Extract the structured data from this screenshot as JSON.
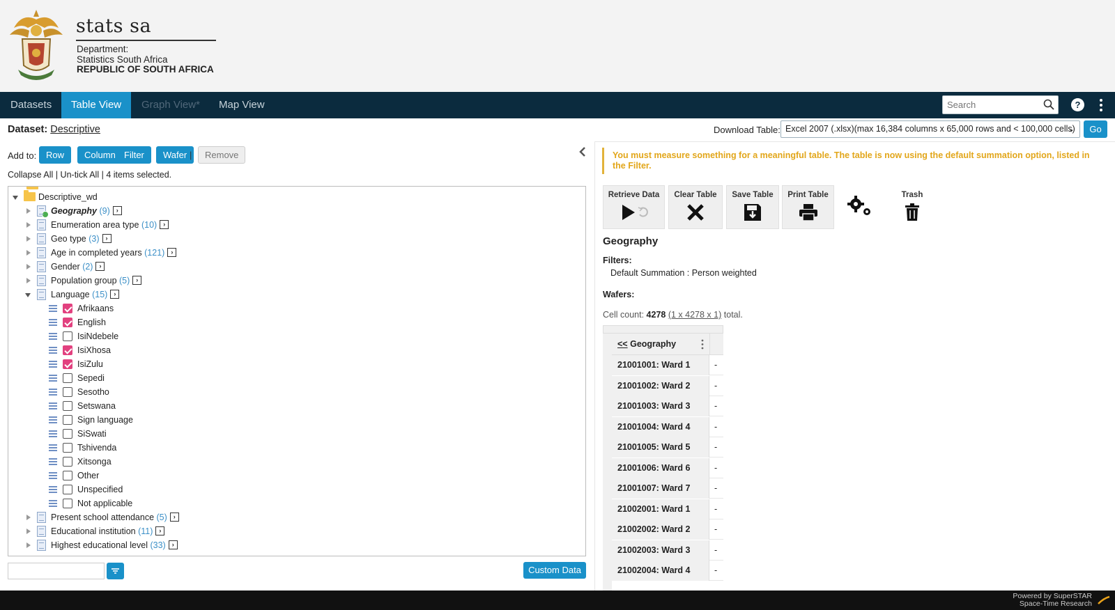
{
  "brand": {
    "name": "stats sa",
    "line1": "Department:",
    "line2": "Statistics South Africa",
    "line3": "REPUBLIC OF SOUTH AFRICA"
  },
  "nav": {
    "tabs": [
      {
        "label": "Datasets",
        "state": "normal"
      },
      {
        "label": "Table View",
        "state": "active"
      },
      {
        "label": "Graph View*",
        "state": "disabled"
      },
      {
        "label": "Map View",
        "state": "normal"
      }
    ],
    "search_placeholder": "Search"
  },
  "dataset": {
    "label": "Dataset:",
    "name": "Descriptive"
  },
  "download": {
    "label": "Download Table:",
    "selected": "Excel 2007 (.xlsx)(max 16,384 columns x 65,000 rows and < 100,000 cells)",
    "go": "Go"
  },
  "add_to": {
    "label": "Add to:",
    "buttons": [
      "Row",
      "Column",
      "Filter",
      "Wafer"
    ],
    "separator": "|",
    "remove": "Remove"
  },
  "collapse_bar": {
    "collapse_all": "Collapse All",
    "untick_all": "Un-tick All",
    "sep": "|",
    "selected_text": "4 items selected."
  },
  "tree": {
    "root": "Descriptive_wd",
    "nodes_before": [
      {
        "label": "Geography",
        "count": "(9)",
        "style": "geo"
      },
      {
        "label": "Enumeration area type",
        "count": "(10)"
      },
      {
        "label": "Geo type",
        "count": "(3)"
      },
      {
        "label": "Age in completed years",
        "count": "(121)"
      },
      {
        "label": "Gender",
        "count": "(2)"
      },
      {
        "label": "Population group",
        "count": "(5)"
      }
    ],
    "expanded": {
      "label": "Language",
      "count": "(15)"
    },
    "children": [
      {
        "label": "Afrikaans",
        "checked": true
      },
      {
        "label": "English",
        "checked": true
      },
      {
        "label": "IsiNdebele",
        "checked": false
      },
      {
        "label": "IsiXhosa",
        "checked": true
      },
      {
        "label": "IsiZulu",
        "checked": true
      },
      {
        "label": "Sepedi",
        "checked": false
      },
      {
        "label": "Sesotho",
        "checked": false
      },
      {
        "label": "Setswana",
        "checked": false
      },
      {
        "label": "Sign language",
        "checked": false
      },
      {
        "label": "SiSwati",
        "checked": false
      },
      {
        "label": "Tshivenda",
        "checked": false
      },
      {
        "label": "Xitsonga",
        "checked": false
      },
      {
        "label": "Other",
        "checked": false
      },
      {
        "label": "Unspecified",
        "checked": false
      },
      {
        "label": "Not applicable",
        "checked": false
      }
    ],
    "nodes_after": [
      {
        "label": "Present school attendance",
        "count": "(5)"
      },
      {
        "label": "Educational institution",
        "count": "(11)"
      },
      {
        "label": "Highest educational level",
        "count": "(33)"
      }
    ]
  },
  "custom_data": "Custom Data",
  "warning": "You must measure something for a meaningful table. The table is now using the default summation option, listed in the Filter.",
  "tools": {
    "retrieve": "Retrieve Data",
    "clear": "Clear Table",
    "save": "Save Table",
    "print": "Print Table",
    "trash": "Trash"
  },
  "table": {
    "title": "Geography",
    "filters_label": "Filters:",
    "filters_value": "Default Summation : Person weighted",
    "wafers_label": "Wafers:",
    "cell_count_label": "Cell count:",
    "cell_count_value": "4278",
    "cell_count_dims": "(1 x 4278 x 1)",
    "cell_count_suffix": "total.",
    "col_header_link": "<<",
    "col_header": "Geography",
    "rows": [
      {
        "label": "21001001: Ward 1",
        "value": "-"
      },
      {
        "label": "21001002: Ward 2",
        "value": "-"
      },
      {
        "label": "21001003: Ward 3",
        "value": "-"
      },
      {
        "label": "21001004: Ward 4",
        "value": "-"
      },
      {
        "label": "21001005: Ward 5",
        "value": "-"
      },
      {
        "label": "21001006: Ward 6",
        "value": "-"
      },
      {
        "label": "21001007: Ward 7",
        "value": "-"
      },
      {
        "label": "21002001: Ward 1",
        "value": "-"
      },
      {
        "label": "21002002: Ward 2",
        "value": "-"
      },
      {
        "label": "21002003: Ward 3",
        "value": "-"
      },
      {
        "label": "21002004: Ward 4",
        "value": "-"
      }
    ]
  },
  "footer": {
    "line1": "Powered by SuperSTAR",
    "line2": "Space-Time Research"
  },
  "colors": {
    "nav_bg": "#0b2b3e",
    "accent": "#1a91c9",
    "warning": "#e2a61a",
    "checked": "#e2417f"
  }
}
